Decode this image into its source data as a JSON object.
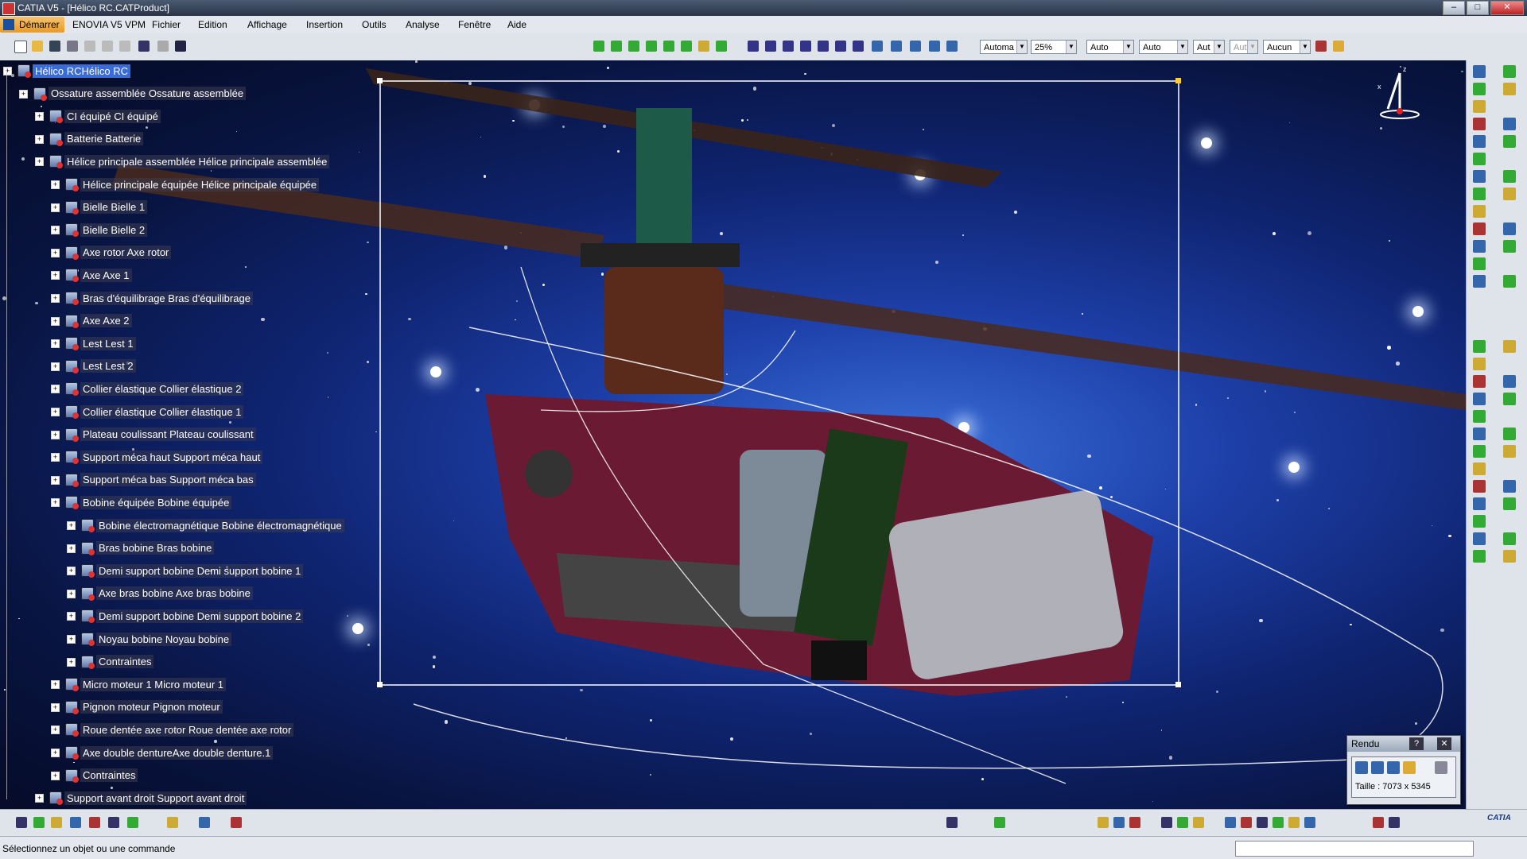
{
  "window": {
    "title": "CATIA V5 - [Hélico RC.CATProduct]",
    "min": "–",
    "max": "□",
    "close": "✕"
  },
  "menu": {
    "start": "Démarrer",
    "items": [
      "ENOVIA V5 VPM",
      "Fichier",
      "Edition",
      "Affichage",
      "Insertion",
      "Outils",
      "Analyse",
      "Fenêtre",
      "Aide"
    ]
  },
  "toolbar": {
    "render_style": "Automa",
    "zoom": "25%",
    "auto1": "Auto",
    "auto2": "Auto",
    "aut3": "Aut",
    "aut4": "Aut",
    "aucun": "Aucun"
  },
  "tree": [
    {
      "label": "Hélico RCHélico RC",
      "level": 0,
      "selected": true
    },
    {
      "label": "Ossature assemblée Ossature assemblée",
      "level": 1
    },
    {
      "label": "CI équipé CI équipé",
      "level": 2
    },
    {
      "label": "Batterie Batterie",
      "level": 2
    },
    {
      "label": "Hélice principale assemblée Hélice principale assemblée",
      "level": 2
    },
    {
      "label": "Hélice principale équipée Hélice principale équipée",
      "level": 3
    },
    {
      "label": "Bielle Bielle 1",
      "level": 3
    },
    {
      "label": "Bielle Bielle 2",
      "level": 3
    },
    {
      "label": "Axe rotor Axe rotor",
      "level": 3
    },
    {
      "label": "Axe Axe 1",
      "level": 3
    },
    {
      "label": "Bras d'équilibrage Bras d'équilibrage",
      "level": 3
    },
    {
      "label": "Axe Axe 2",
      "level": 3
    },
    {
      "label": "Lest Lest 1",
      "level": 3
    },
    {
      "label": "Lest Lest 2",
      "level": 3
    },
    {
      "label": "Collier élastique Collier élastique 2",
      "level": 3
    },
    {
      "label": "Collier élastique Collier élastique 1",
      "level": 3
    },
    {
      "label": "Plateau coulissant Plateau coulissant",
      "level": 3
    },
    {
      "label": "Support méca haut Support méca haut",
      "level": 3
    },
    {
      "label": "Support méca bas Support méca bas",
      "level": 3
    },
    {
      "label": "Bobine équipée Bobine équipée",
      "level": 3
    },
    {
      "label": "Bobine électromagnétique Bobine électromagnétique",
      "level": 4
    },
    {
      "label": "Bras bobine Bras bobine",
      "level": 4
    },
    {
      "label": "Demi support bobine Demi support bobine 1",
      "level": 4
    },
    {
      "label": "Axe bras bobine Axe bras bobine",
      "level": 4
    },
    {
      "label": "Demi support bobine Demi support bobine 2",
      "level": 4
    },
    {
      "label": "Noyau bobine Noyau bobine",
      "level": 4
    },
    {
      "label": "Contraintes",
      "level": 4
    },
    {
      "label": "Micro moteur 1 Micro moteur 1",
      "level": 3
    },
    {
      "label": "Pignon moteur Pignon moteur",
      "level": 3
    },
    {
      "label": "Roue dentée axe rotor Roue dentée axe rotor",
      "level": 3
    },
    {
      "label": "Axe double dentureAxe double denture.1",
      "level": 3
    },
    {
      "label": "Contraintes",
      "level": 3
    },
    {
      "label": "Support avant droit Support avant droit",
      "level": 2
    }
  ],
  "rendu": {
    "title": "Rendu",
    "help": "?",
    "close": "✕",
    "size": "Taille : 7073 x 5345"
  },
  "status": {
    "message": "Sélectionnez un objet ou une commande"
  },
  "logo": "CATIA",
  "compass": {
    "x_label": "x",
    "z_label": "z"
  },
  "colors": {
    "accent": "#3a6cd8",
    "background": "#0f2470"
  }
}
